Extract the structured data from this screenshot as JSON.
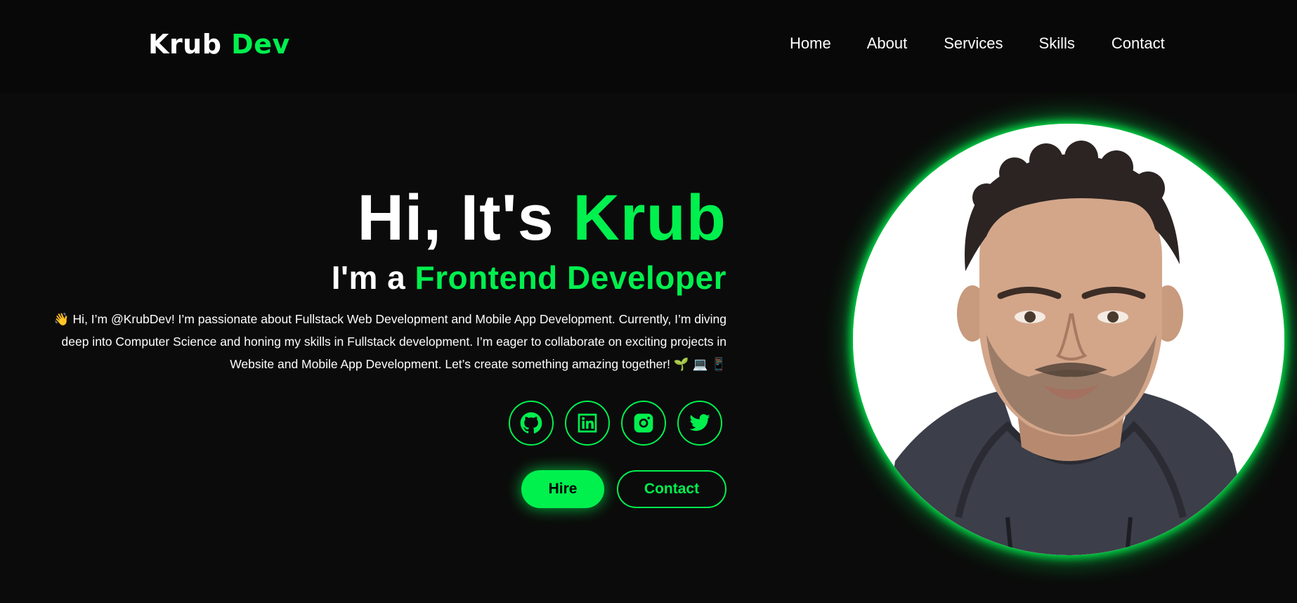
{
  "logo": {
    "part1": "Krub ",
    "part2": "Dev"
  },
  "nav": {
    "items": [
      "Home",
      "About",
      "Services",
      "Skills",
      "Contact"
    ]
  },
  "hero": {
    "greeting": "Hi, It's ",
    "name": "Krub",
    "role_prefix": "I'm a ",
    "role": "Frontend Developer",
    "intro": "👋 Hi, I’m @KrubDev! I’m passionate about Fullstack Web Development and Mobile App Development. Currently, I’m diving deep into Computer Science and honing my skills in Fullstack development. I’m eager to collaborate on exciting projects in Website and Mobile App Development. Let’s create something amazing together! 🌱 💻 📱",
    "socials": [
      "github-icon",
      "linkedin-icon",
      "instagram-icon",
      "twitter-icon"
    ],
    "hire_label": "Hire",
    "contact_label": "Contact"
  },
  "colors": {
    "accent": "#00f04e",
    "background": "#0b0b0b",
    "navbar": "#080808"
  }
}
